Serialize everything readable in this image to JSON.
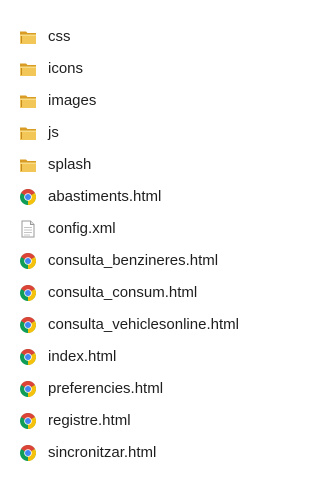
{
  "files": [
    {
      "name": "css",
      "type": "folder",
      "icon": "folder-icon"
    },
    {
      "name": "icons",
      "type": "folder",
      "icon": "folder-icon"
    },
    {
      "name": "images",
      "type": "folder",
      "icon": "folder-icon"
    },
    {
      "name": "js",
      "type": "folder",
      "icon": "folder-icon"
    },
    {
      "name": "splash",
      "type": "folder",
      "icon": "folder-icon"
    },
    {
      "name": "abastiments.html",
      "type": "html",
      "icon": "chrome-icon"
    },
    {
      "name": "config.xml",
      "type": "xml",
      "icon": "document-icon"
    },
    {
      "name": "consulta_benzineres.html",
      "type": "html",
      "icon": "chrome-icon"
    },
    {
      "name": "consulta_consum.html",
      "type": "html",
      "icon": "chrome-icon"
    },
    {
      "name": "consulta_vehiclesonline.html",
      "type": "html",
      "icon": "chrome-icon"
    },
    {
      "name": "index.html",
      "type": "html",
      "icon": "chrome-icon"
    },
    {
      "name": "preferencies.html",
      "type": "html",
      "icon": "chrome-icon"
    },
    {
      "name": "registre.html",
      "type": "html",
      "icon": "chrome-icon"
    },
    {
      "name": "sincronitzar.html",
      "type": "html",
      "icon": "chrome-icon"
    }
  ],
  "colors": {
    "text": "#1e1e1e",
    "folder": "#e8b53c",
    "chrome_red": "#db4437",
    "chrome_yellow": "#f4c20d",
    "chrome_green": "#0f9d58",
    "chrome_blue": "#4285f4"
  }
}
